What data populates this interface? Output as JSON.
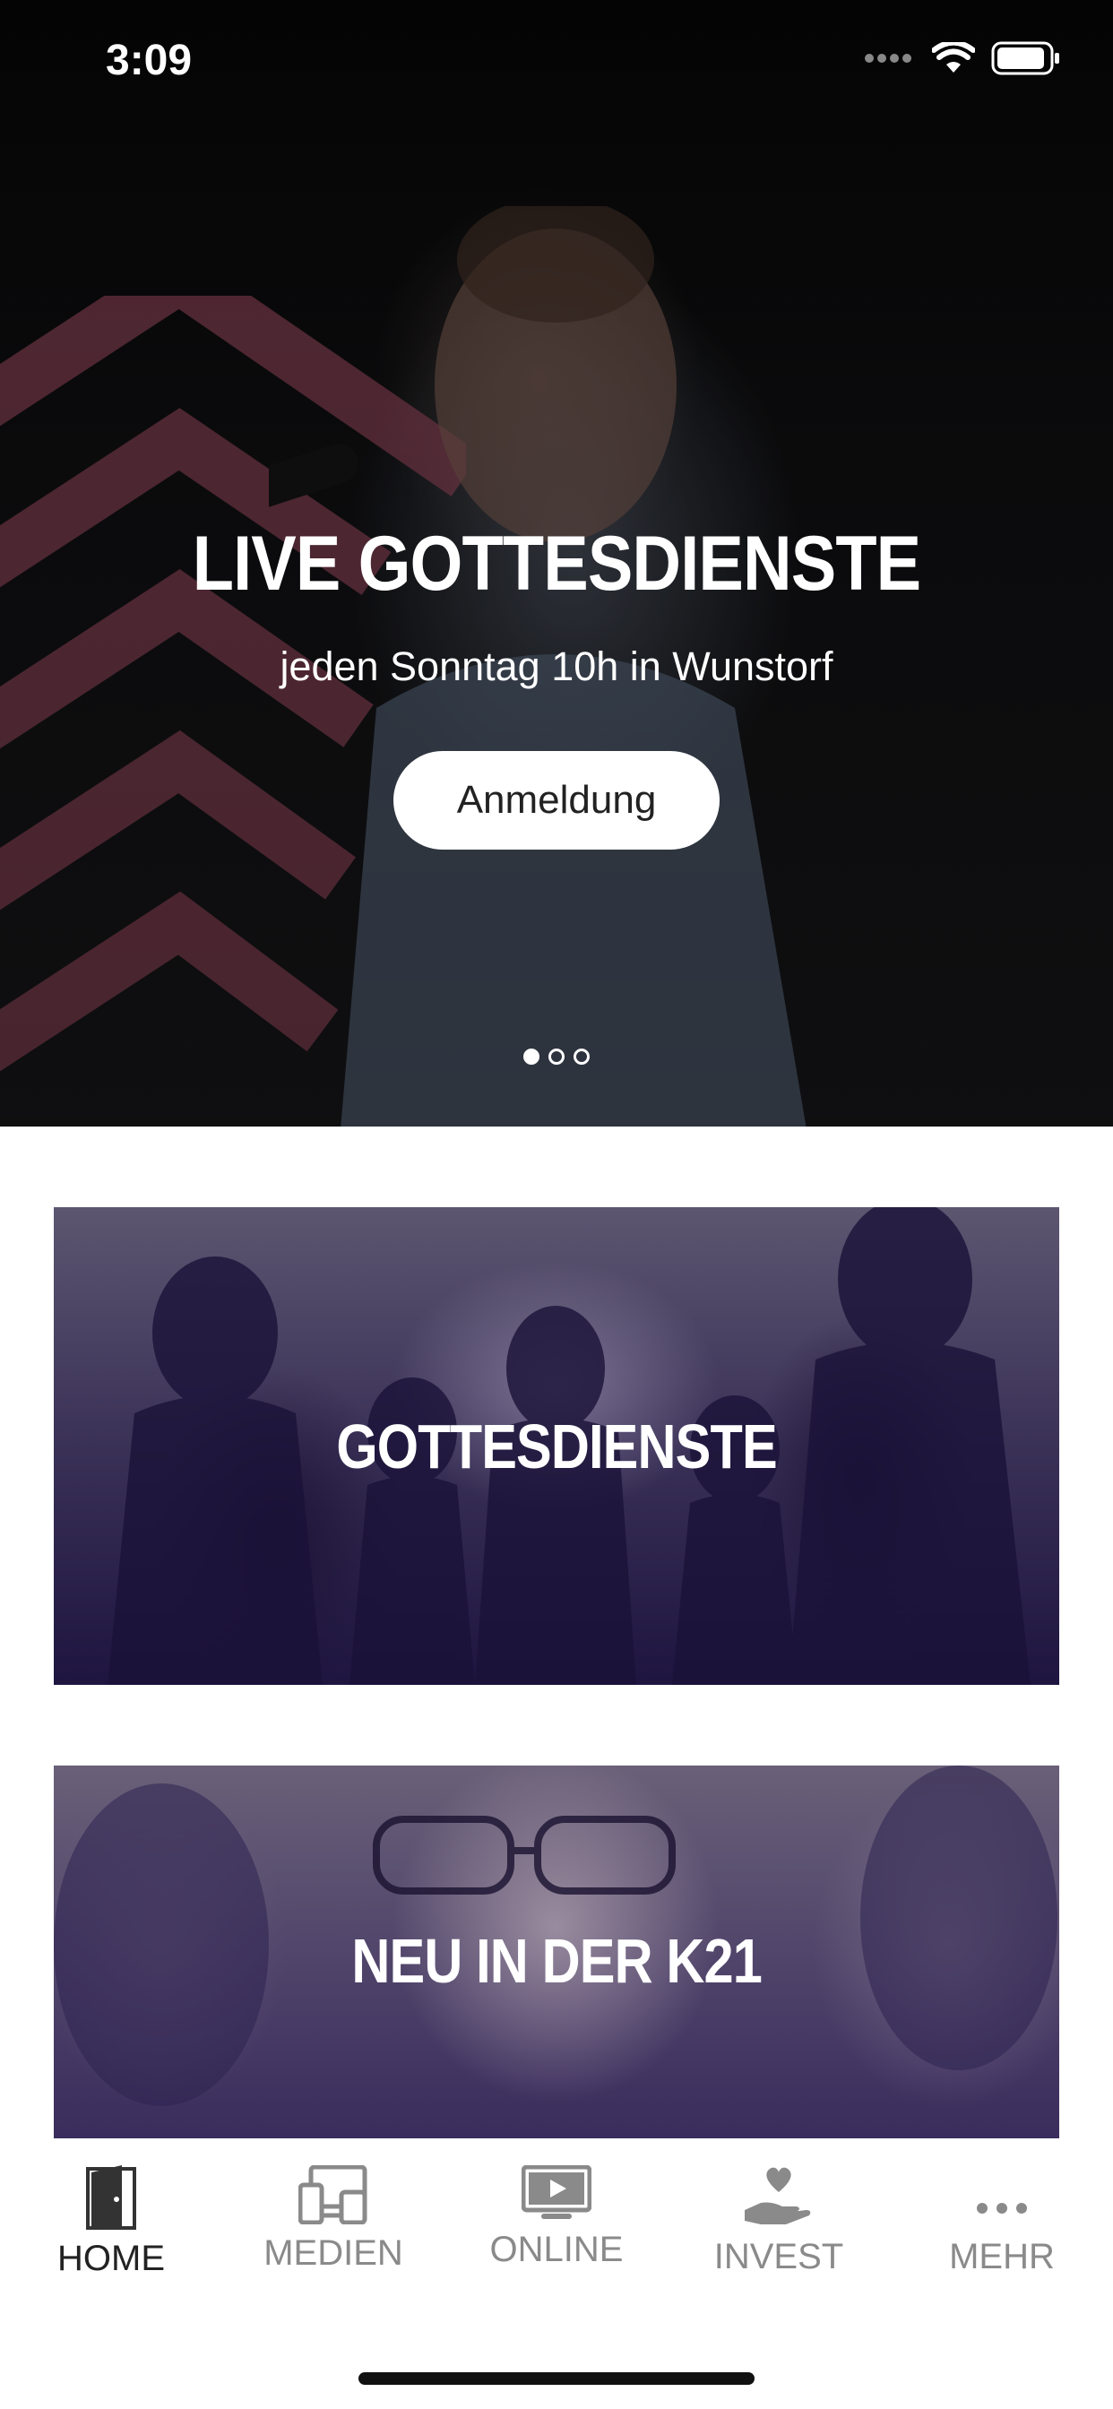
{
  "status": {
    "time": "3:09"
  },
  "hero": {
    "title": "LIVE GOTTESDIENSTE",
    "subtitle": "jeden Sonntag 10h in Wunstorf",
    "button_label": "Anmeldung",
    "slides_total": 3,
    "slide_active": 1
  },
  "cards": [
    {
      "label": "GOTTESDIENSTE"
    },
    {
      "label": "NEU IN DER K21"
    }
  ],
  "tabbar": {
    "items": [
      {
        "label": "HOME",
        "icon": "door-icon",
        "active": true
      },
      {
        "label": "MEDIEN",
        "icon": "devices-icon",
        "active": false
      },
      {
        "label": "ONLINE",
        "icon": "play-screen-icon",
        "active": false
      },
      {
        "label": "INVEST",
        "icon": "hand-heart-icon",
        "active": false
      },
      {
        "label": "MEHR",
        "icon": "more-dots-icon",
        "active": false
      }
    ]
  },
  "colors": {
    "active_tab": "#222222",
    "inactive_tab": "#8a8a8a",
    "card_tint": "#2a1f4d"
  }
}
